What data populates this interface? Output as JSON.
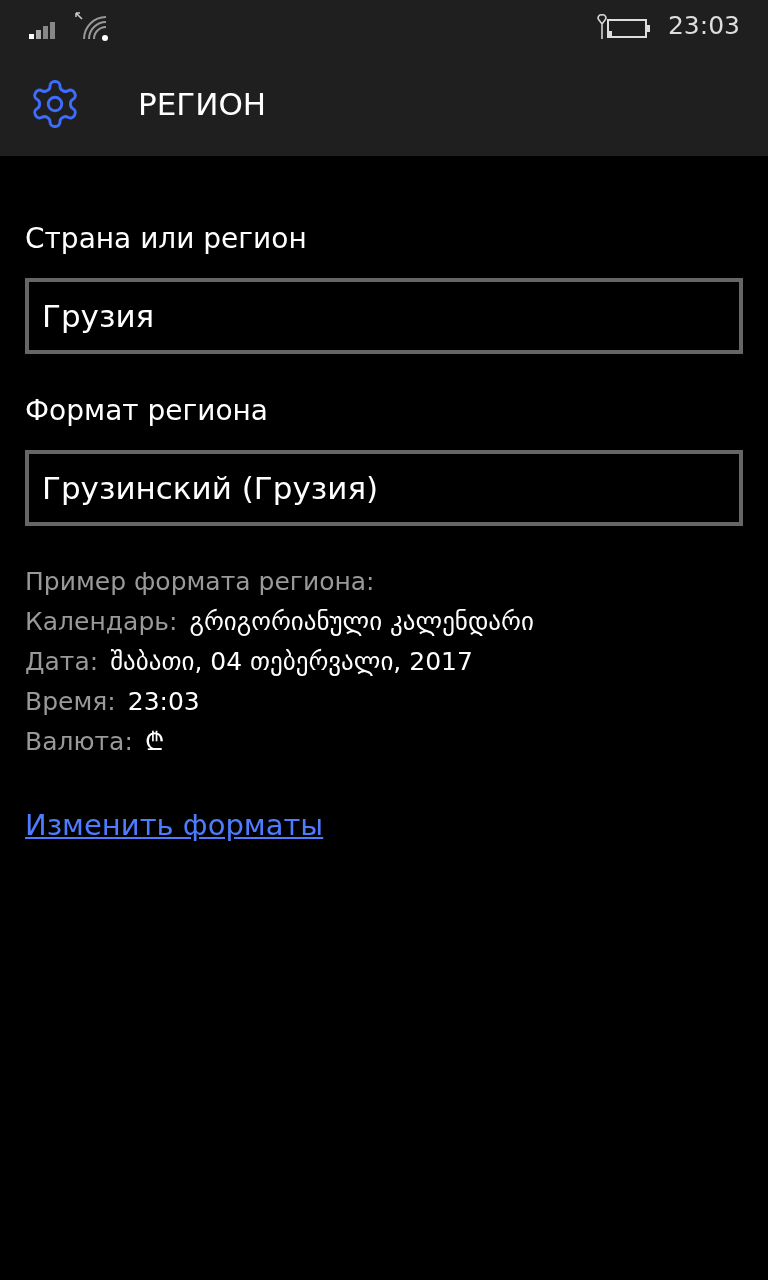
{
  "status_bar": {
    "time": "23:03"
  },
  "header": {
    "title": "РЕГИОН"
  },
  "fields": [
    {
      "label": "Страна или регион",
      "value": "Грузия"
    },
    {
      "label": "Формат региона",
      "value": "Грузинский (Грузия)"
    }
  ],
  "sample": {
    "heading": "Пример формата региона:",
    "rows": [
      {
        "label": "Календарь:",
        "value": "გრიგორიანული კალენდარი"
      },
      {
        "label": "Дата:",
        "value": "შაბათი, 04 თებერვალი, 2017"
      },
      {
        "label": "Время:",
        "value": "23:03"
      },
      {
        "label": "Валюта:",
        "value": "₾"
      }
    ]
  },
  "link": "Изменить форматы"
}
